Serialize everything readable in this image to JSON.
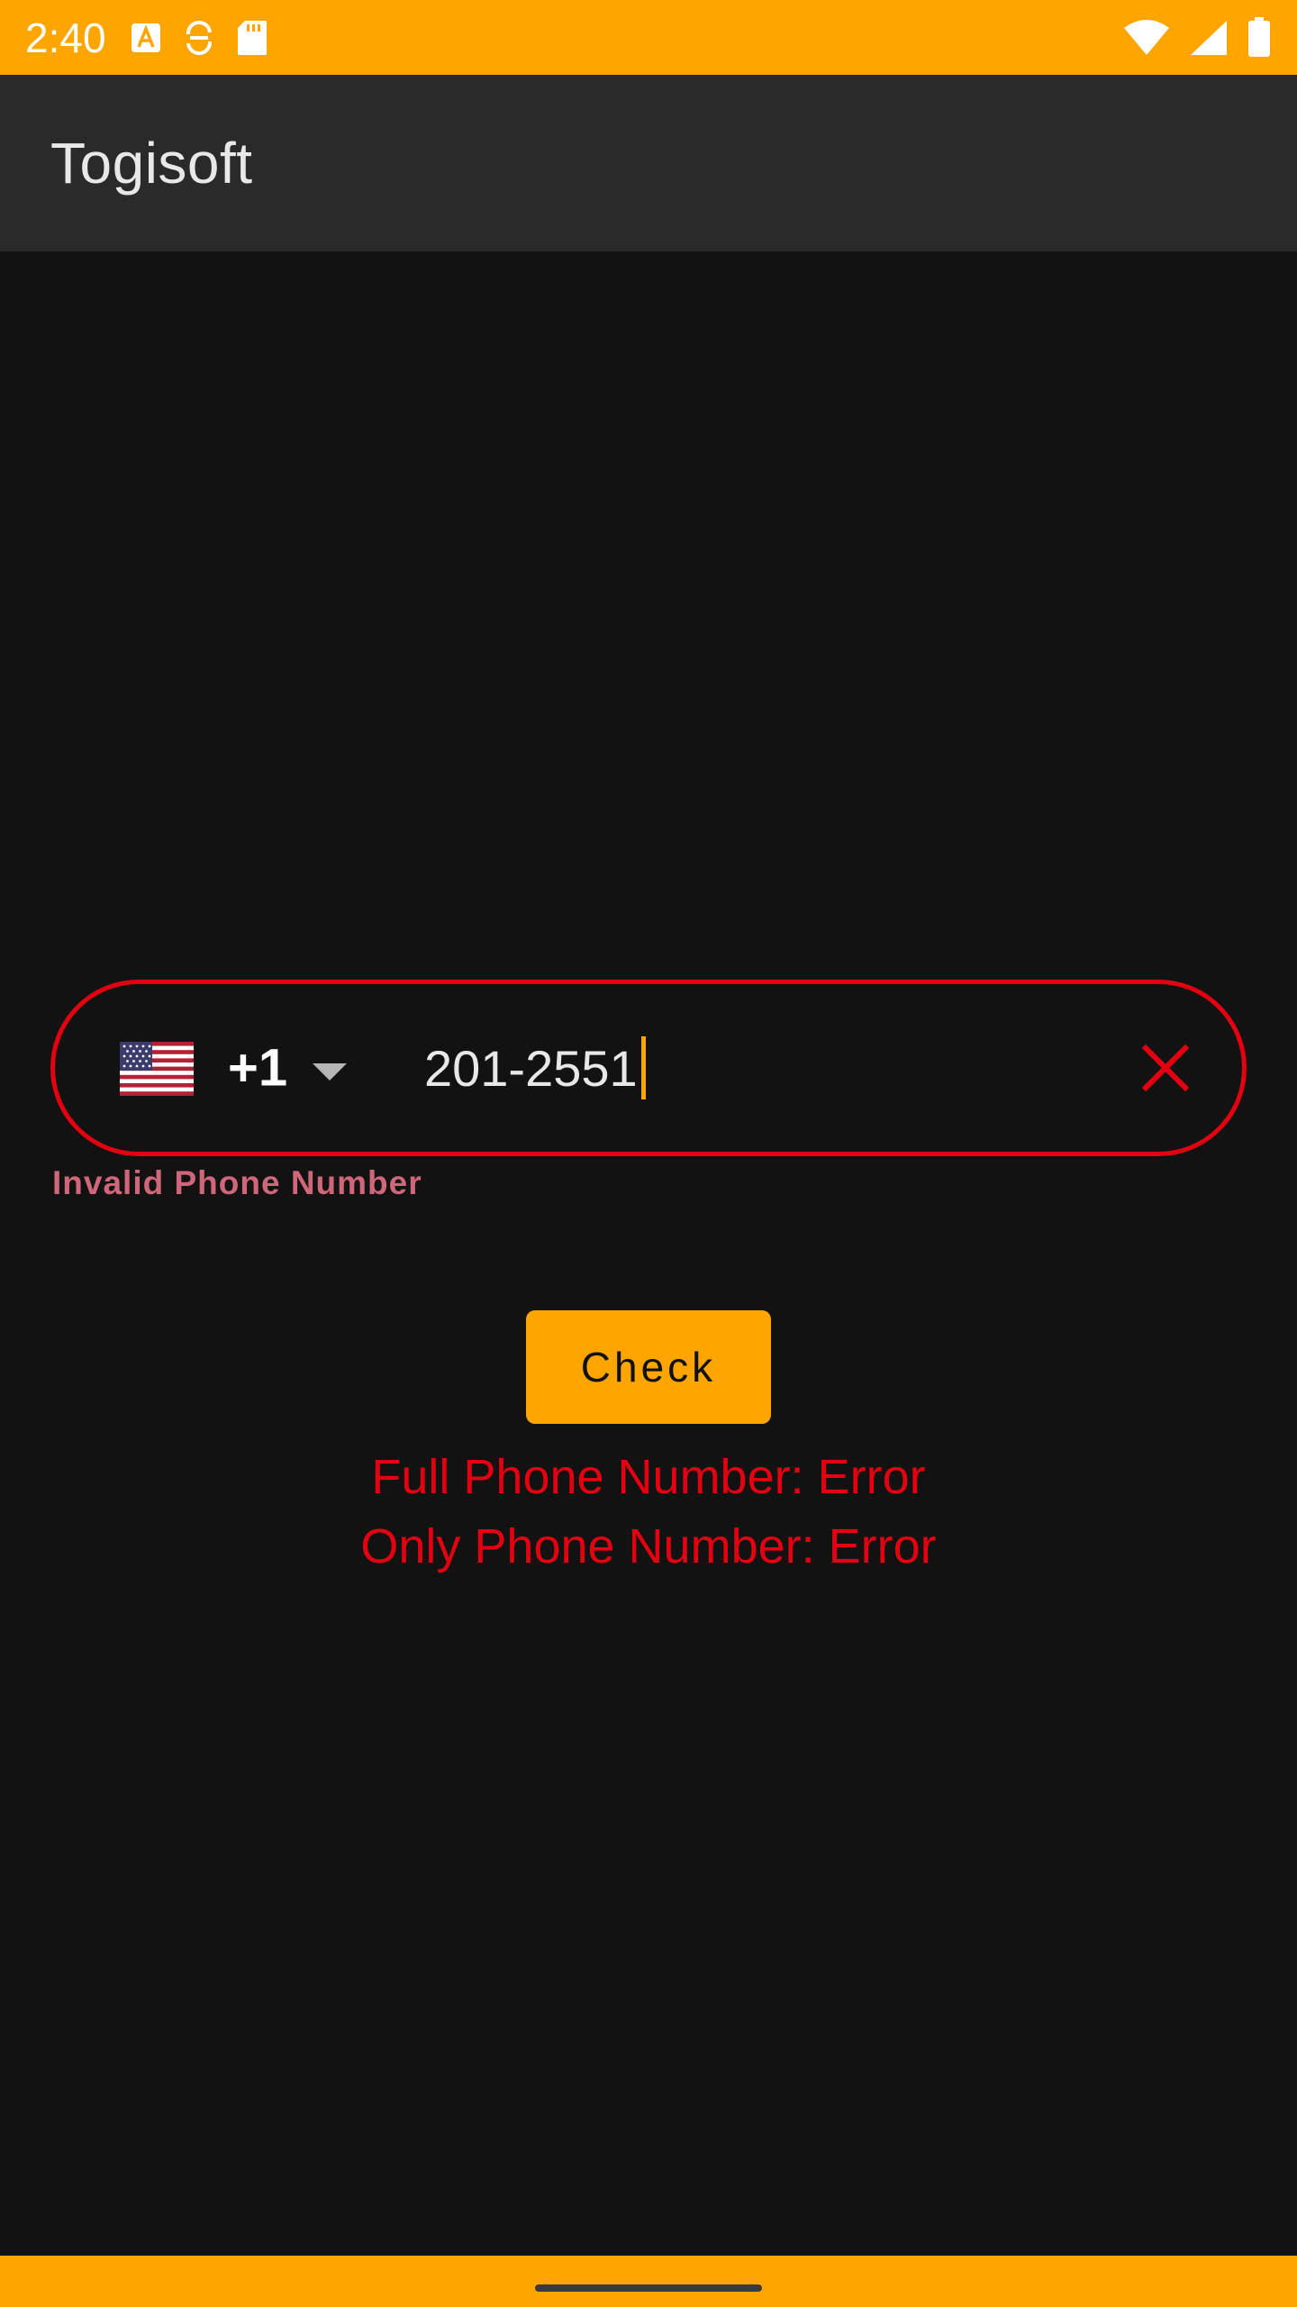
{
  "status_bar": {
    "time": "2:40",
    "background_color": "#FFA500",
    "left_icons": [
      "font-a-icon",
      "sync-icon",
      "sd-card-icon"
    ],
    "right_icons": [
      "wifi-icon",
      "signal-icon",
      "battery-icon"
    ]
  },
  "app_bar": {
    "title": "Togisoft",
    "background_color": "#2a2a2a"
  },
  "phone_field": {
    "country_flag": "us-flag-icon",
    "dial_code": "+1",
    "value": "201-2551",
    "error_text": "Invalid Phone Number",
    "border_color": "#e30010",
    "clear_icon": "close-icon"
  },
  "check_button": {
    "label": "Check",
    "color": "#FFA500"
  },
  "results": {
    "full_phone": "Full Phone Number: Error",
    "only_phone": "Only Phone Number: Error",
    "color": "#e30010"
  },
  "theme": {
    "accent": "#FFA500",
    "background": "#121212",
    "error": "#e30010"
  }
}
